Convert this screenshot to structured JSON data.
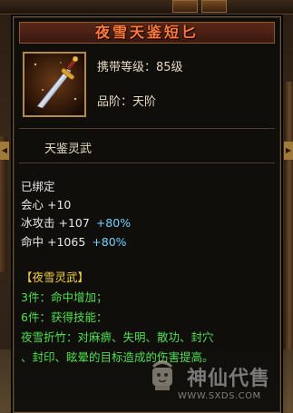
{
  "item": {
    "name": "夜雪天鉴短匕",
    "level_line": "携带等级：85级",
    "grade_line": "品阶：天阶",
    "series": "天鉴灵武"
  },
  "stats": {
    "bound": "已绑定",
    "lines": [
      {
        "label": "会心",
        "value": "+10",
        "pct": ""
      },
      {
        "label": "冰攻击",
        "value": "+107",
        "pct": "+80%"
      },
      {
        "label": "命中",
        "value": "+1065",
        "pct": "+80%"
      }
    ]
  },
  "set": {
    "title": "【夜雪灵武】",
    "lines": [
      "3件：命中增加；",
      "6件：获得技能：",
      "夜雪折竹：对麻痹、失明、散功、封穴",
      "、封印、眩晕的目标造成的伤害提高。"
    ]
  },
  "watermark": {
    "text": "神仙代售",
    "url": "WWW.SXDS.COM"
  },
  "colors": {
    "title": "#ff7a3a",
    "percent": "#6fd3ff",
    "set_title": "#f5d23a",
    "set_lines": "#4fe04f"
  }
}
